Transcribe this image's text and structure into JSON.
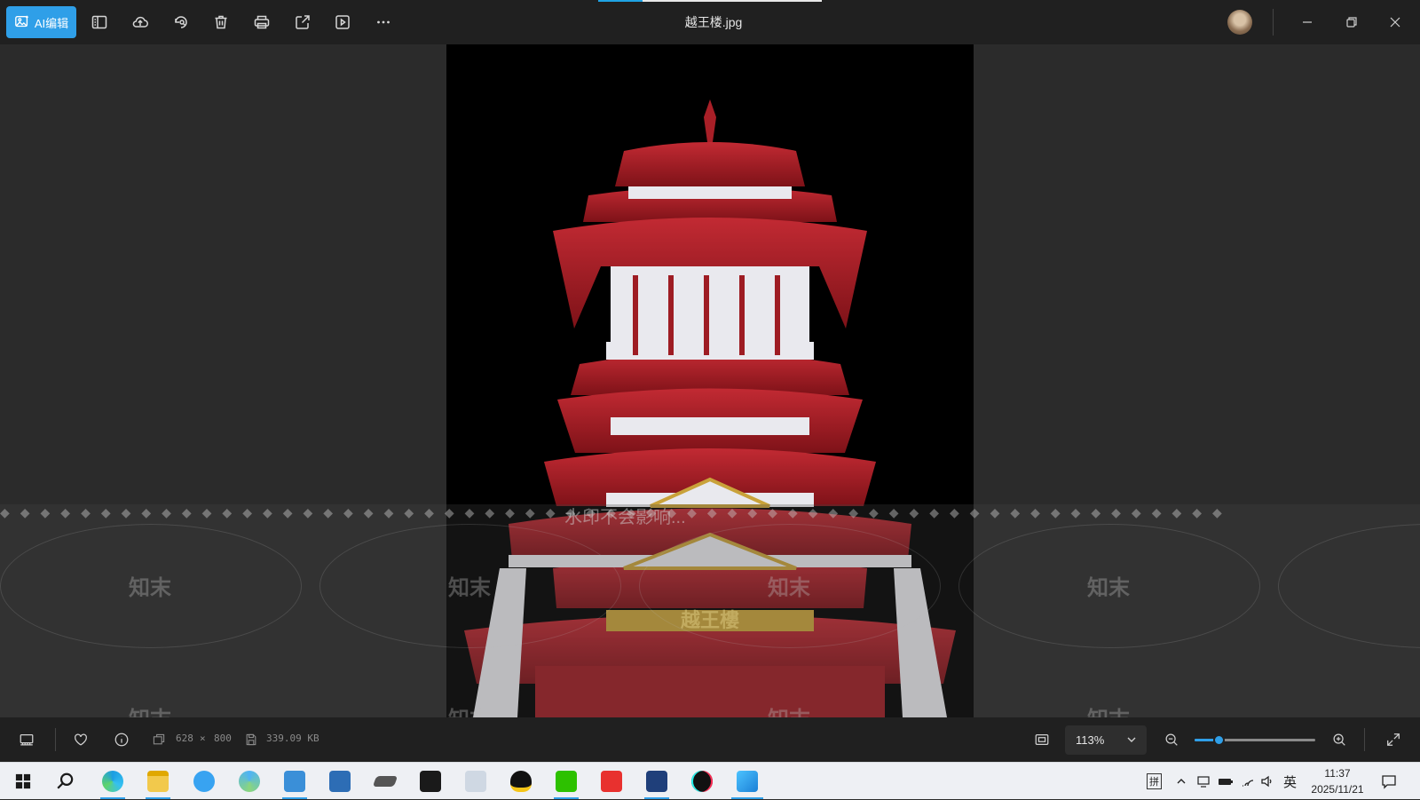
{
  "window": {
    "title": "越王楼.jpg",
    "load_progress": 0.2
  },
  "toolbar": {
    "ai_edit_label": "AI编辑",
    "icons": [
      "panel-icon",
      "upload-icon",
      "rotate-icon",
      "delete-icon",
      "print-icon",
      "share-icon",
      "slideshow-icon",
      "more-icon"
    ]
  },
  "image": {
    "signboard_text": "越王樓"
  },
  "watermark": {
    "brand": "知末",
    "notice": "水印不会影响..."
  },
  "status": {
    "width": "628",
    "times": "×",
    "height": "800",
    "file_size": "339.09 KB",
    "zoom": "113%",
    "zoom_slider_fraction": 0.2
  },
  "taskbar": {
    "apps": [
      "start",
      "search",
      "edge",
      "file-explorer",
      "translate",
      "copilot",
      "video-editor",
      "sketch",
      "tablet",
      "terminal",
      "image-viewer-2",
      "qq",
      "wechat",
      "wps",
      "cat-app",
      "tiktok",
      "photos"
    ],
    "tray": {
      "ime_label": "拼",
      "lang_label": "英",
      "time": "11:37",
      "date": "2025/11/21"
    }
  },
  "colors": {
    "accent": "#2f9fe8",
    "toolbar_bg": "#202020",
    "canvas_bg": "#2b2b2b",
    "pagoda_red": "#b3222b"
  }
}
